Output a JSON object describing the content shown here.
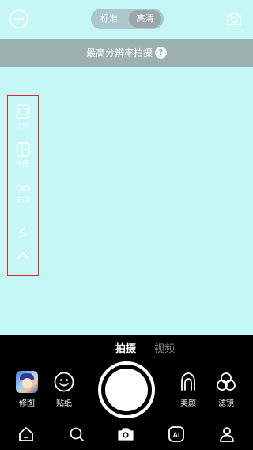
{
  "top_bar": {
    "quality_options": [
      "标准",
      "高清"
    ],
    "selected_quality": "高清"
  },
  "banner": {
    "text": "最高分辨率拍摄",
    "help": "?"
  },
  "side_tools": {
    "ratio": "比例",
    "grid": "构图",
    "loop": "来回"
  },
  "modes": {
    "photo": "拍摄",
    "video": "视频",
    "active": "拍摄"
  },
  "actions": {
    "edit": "修图",
    "sticker": "贴纸",
    "beauty": "美颜",
    "filter": "滤镜"
  },
  "nav": {
    "ai_icon_text": "Ai",
    "active": "camera"
  },
  "colors": {
    "viewfinder": "#c5f7f5",
    "banner": "#9cb0b0",
    "highlight_border": "#e8202a"
  }
}
